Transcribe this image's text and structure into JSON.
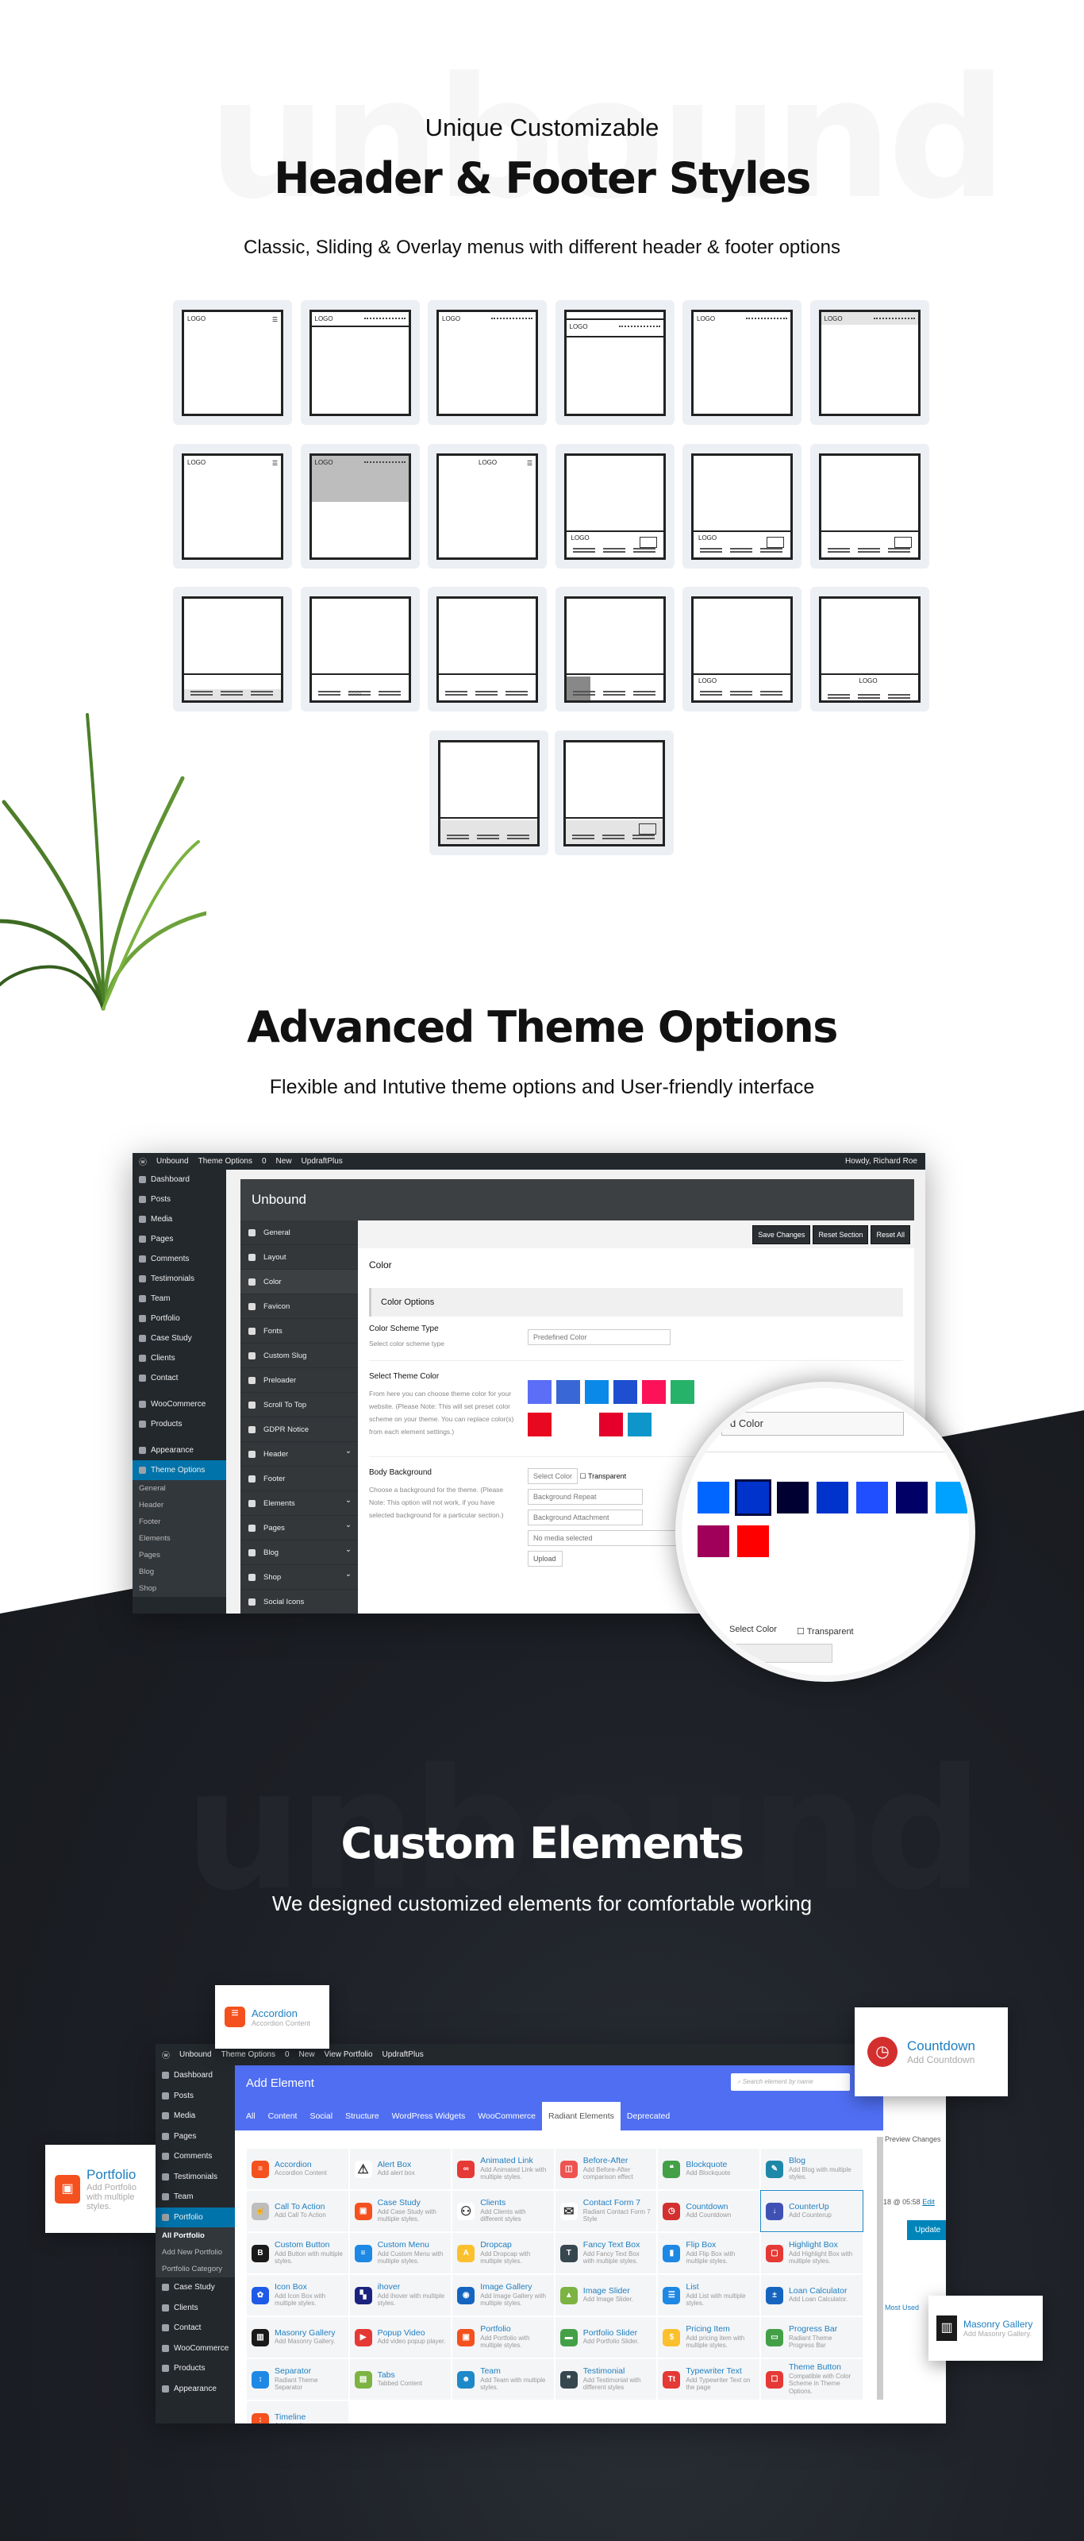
{
  "section1": {
    "watermark": "unbound",
    "subtitle": "Unique Customizable",
    "title": "Header & Footer Styles",
    "description": "Classic, Sliding & Overlay menus with different header & footer options",
    "thumbnails": [
      {
        "kind": "header",
        "variant": "burger",
        "logo": "LOGO"
      },
      {
        "kind": "header",
        "variant": "menu-line",
        "logo": "LOGO"
      },
      {
        "kind": "header",
        "variant": "menu",
        "logo": "LOGO"
      },
      {
        "kind": "header",
        "variant": "topbar",
        "logo": "LOGO"
      },
      {
        "kind": "header",
        "variant": "bold-menu",
        "logo": "LOGO"
      },
      {
        "kind": "header",
        "variant": "grey-bar",
        "logo": "LOGO"
      },
      {
        "kind": "header",
        "variant": "icons",
        "logo": "LOGO"
      },
      {
        "kind": "header",
        "variant": "grey-hero",
        "logo": "LOGO"
      },
      {
        "kind": "header",
        "variant": "centered",
        "logo": "LOGO"
      },
      {
        "kind": "footer",
        "variant": "logo-box",
        "logo": "LOGO"
      },
      {
        "kind": "footer",
        "variant": "logo-lines-box",
        "logo": "LOGO"
      },
      {
        "kind": "footer",
        "variant": "lines-box",
        "logo": ""
      },
      {
        "kind": "footer",
        "variant": "grey-band",
        "logo": ""
      },
      {
        "kind": "footer",
        "variant": "social-dots",
        "logo": ""
      },
      {
        "kind": "footer",
        "variant": "columns",
        "logo": ""
      },
      {
        "kind": "footer",
        "variant": "dark-col",
        "logo": ""
      },
      {
        "kind": "footer",
        "variant": "columns-logo",
        "logo": "LOGO"
      },
      {
        "kind": "footer",
        "variant": "logo-center",
        "logo": "LOGO"
      },
      {
        "kind": "footer",
        "variant": "columns-grey",
        "logo": ""
      },
      {
        "kind": "footer",
        "variant": "grey-box",
        "logo": ""
      }
    ]
  },
  "section2": {
    "title": "Advanced Theme Options",
    "description": "Flexible and Intutive theme options and User-friendly interface",
    "adminbar": {
      "site": "Unbound",
      "theme_options": "Theme Options",
      "comments": "0",
      "new": "New",
      "plugin": "UpdraftPlus",
      "howdy": "Howdy, Richard Roe"
    },
    "sidebar": [
      "Dashboard",
      "Posts",
      "Media",
      "Pages",
      "Comments",
      "Testimonials",
      "Team",
      "Portfolio",
      "Case Study",
      "Clients",
      "Contact",
      "WooCommerce",
      "Products",
      "Appearance",
      "Theme Options"
    ],
    "sidebar_active": "Theme Options",
    "sidebar_sub": [
      "General",
      "Header",
      "Footer",
      "Elements",
      "Pages",
      "Blog",
      "Shop"
    ],
    "panel_title": "Unbound",
    "nav": [
      {
        "label": "General",
        "chev": false
      },
      {
        "label": "Layout",
        "chev": false
      },
      {
        "label": "Color",
        "chev": false
      },
      {
        "label": "Favicon",
        "chev": false
      },
      {
        "label": "Fonts",
        "chev": false
      },
      {
        "label": "Custom Slug",
        "chev": false
      },
      {
        "label": "Preloader",
        "chev": false
      },
      {
        "label": "Scroll To Top",
        "chev": false
      },
      {
        "label": "GDPR Notice",
        "chev": false
      },
      {
        "label": "Header",
        "chev": true
      },
      {
        "label": "Footer",
        "chev": false
      },
      {
        "label": "Elements",
        "chev": true
      },
      {
        "label": "Pages",
        "chev": true
      },
      {
        "label": "Blog",
        "chev": true
      },
      {
        "label": "Shop",
        "chev": true
      },
      {
        "label": "Social Icons",
        "chev": false
      }
    ],
    "buttons": {
      "save": "Save Changes",
      "reset_section": "Reset Section",
      "reset_all": "Reset All"
    },
    "section_title": "Color",
    "group_title": "Color Options",
    "scheme": {
      "label": "Color Scheme Type",
      "help": "Select color scheme type",
      "value": "Predefined Color"
    },
    "theme_color": {
      "label": "Select Theme Color",
      "help": "From here you can choose theme color for your website. (Please Note: This will set preset color scheme on your theme. You can replace color(s) from each element settings.)",
      "swatches": [
        "#5b6ef5",
        "#3a67d6",
        "#0b89e8",
        "#1e4fd0",
        "#fb1259",
        "#27b26a",
        "#e8081f",
        "#e4002b",
        "#0e95c9"
      ]
    },
    "body_bg": {
      "label": "Body Background",
      "help": "Choose a background for the theme. (Please Note: This option will not work, if you have selected background for a particular section.)",
      "select_color": "Select Color",
      "transparent": "Transparent",
      "repeat": "Background Repeat",
      "attachment": "Background Attachment",
      "media": "No media selected",
      "upload": "Upload"
    },
    "magnifier": {
      "select_value": "d Color",
      "swatches": [
        "#0066ff",
        "#0033cc",
        "#000033",
        "#0033cc",
        "#1f4fff",
        "#000066",
        "#00a2ff",
        "#a0005a",
        "#ff0000"
      ],
      "selected_index": 1,
      "select_color": "Select Color",
      "transparent": "Transparent",
      "repeat": "peat"
    }
  },
  "section3": {
    "watermark": "unbound",
    "title": "Custom Elements",
    "description": "We designed customized elements  for comfortable working",
    "adminbar": {
      "site": "Unbound",
      "theme_options": "Theme Options",
      "comments": "0",
      "new": "New",
      "view": "View Portfolio",
      "plugin": "UpdraftPlus"
    },
    "sidebar": [
      "Dashboard",
      "Posts",
      "Media",
      "Pages",
      "Comments",
      "Testimonials",
      "Team",
      "Portfolio"
    ],
    "sidebar_sub": [
      "All Portfolio",
      "Add New Portfolio",
      "Portfolio Category"
    ],
    "sidebar_after": [
      "Case Study",
      "Clients",
      "Contact",
      "WooCommerce",
      "Products",
      "Appearance"
    ],
    "modal_title": "Add Element",
    "search_placeholder": "Search element by name",
    "tabs": [
      "All",
      "Content",
      "Social",
      "Structure",
      "WordPress Widgets",
      "WooCommerce",
      "Radiant Elements",
      "Deprecated"
    ],
    "active_tab": "Radiant Elements",
    "right": {
      "preview": "Preview Changes",
      "date": "18 @ 05:58",
      "edit": "Edit",
      "update": "Update",
      "most_used": "Most Used"
    },
    "elements": [
      {
        "t": "Accordion",
        "d": "Accordion Content",
        "c": "#f4511e",
        "g": "≡"
      },
      {
        "t": "Alert Box",
        "d": "Add alert box",
        "c": "#ffffff",
        "g": "⚠"
      },
      {
        "t": "Animated Link",
        "d": "Add Animated Link with multiple styles.",
        "c": "#e53935",
        "g": "∞"
      },
      {
        "t": "Before-After",
        "d": "Add Before-After comparison effect",
        "c": "#ef5350",
        "g": "◫"
      },
      {
        "t": "Blockquote",
        "d": "Add Blockquote",
        "c": "#43a047",
        "g": "❝"
      },
      {
        "t": "Blog",
        "d": "Add Blog with multiple styles.",
        "c": "#1e88a8",
        "g": "✎"
      },
      {
        "t": "Call To Action",
        "d": "Add Call To Action",
        "c": "#bdbdbd",
        "g": "☝"
      },
      {
        "t": "Case Study",
        "d": "Add Case Study with multiple styles.",
        "c": "#f4511e",
        "g": "▣"
      },
      {
        "t": "Clients",
        "d": "Add Clients with different styles",
        "c": "#ffffff",
        "g": "⚇"
      },
      {
        "t": "Contact Form 7",
        "d": "Radiant Contact Form 7 Style",
        "c": "#ffffff",
        "g": "✉"
      },
      {
        "t": "Countdown",
        "d": "Add Countdown",
        "c": "#d32f2f",
        "g": "◷"
      },
      {
        "t": "CounterUp",
        "d": "Add Counterup",
        "c": "#3f51b5",
        "g": "↓"
      },
      {
        "t": "Custom Button",
        "d": "Add Button with multiple styles.",
        "c": "#1a1a1a",
        "g": "B"
      },
      {
        "t": "Custom Menu",
        "d": "Add Custom Menu with multiple styles.",
        "c": "#1e88e5",
        "g": "≡"
      },
      {
        "t": "Dropcap",
        "d": "Add Dropcap with multiple styles.",
        "c": "#fbc02d",
        "g": "A"
      },
      {
        "t": "Fancy Text Box",
        "d": "Add Fancy Text Box with multiple styles.",
        "c": "#37474f",
        "g": "T"
      },
      {
        "t": "Flip Box",
        "d": "Add Flip Box with multiple styles.",
        "c": "#1e88e5",
        "g": "▮"
      },
      {
        "t": "Highlight Box",
        "d": "Add Highlight Box with multiple styles.",
        "c": "#e53935",
        "g": "▢"
      },
      {
        "t": "Icon Box",
        "d": "Add Icon Box with multiple styles.",
        "c": "#1e5ae8",
        "g": "✿"
      },
      {
        "t": "ihover",
        "d": "Add ihover with multiple styles.",
        "c": "#1a237e",
        "g": "▚"
      },
      {
        "t": "Image Gallery",
        "d": "Add Image Gallery with multiple styles.",
        "c": "#1565c0",
        "g": "◉"
      },
      {
        "t": "Image Slider",
        "d": "Add Image Slider.",
        "c": "#7cb342",
        "g": "▲"
      },
      {
        "t": "List",
        "d": "Add List with multiple styles.",
        "c": "#1e88e5",
        "g": "☰"
      },
      {
        "t": "Loan Calculator",
        "d": "Add Loan Calculator.",
        "c": "#1565c0",
        "g": "±"
      },
      {
        "t": "Masonry Gallery",
        "d": "Add Masonry Gallery.",
        "c": "#1a1a1a",
        "g": "▥"
      },
      {
        "t": "Popup Video",
        "d": "Add video popup player.",
        "c": "#e53935",
        "g": "▶"
      },
      {
        "t": "Portfolio",
        "d": "Add Portfolio with multiple styles.",
        "c": "#f4511e",
        "g": "▣"
      },
      {
        "t": "Portfolio Slider",
        "d": "Add Portfolio Slider.",
        "c": "#43a047",
        "g": "▬"
      },
      {
        "t": "Pricing Item",
        "d": "Add pricing item with multiple styles.",
        "c": "#fbc02d",
        "g": "$"
      },
      {
        "t": "Progress Bar",
        "d": "Radiant Theme Progress Bar",
        "c": "#43a047",
        "g": "▭"
      },
      {
        "t": "Separator",
        "d": "Radiant Theme Separator",
        "c": "#1e88e5",
        "g": "↕"
      },
      {
        "t": "Tabs",
        "d": "Tabbed Content",
        "c": "#7cb342",
        "g": "▤"
      },
      {
        "t": "Team",
        "d": "Add Team with multiple styles.",
        "c": "#1e88c8",
        "g": "☻"
      },
      {
        "t": "Testimonial",
        "d": "Add Testimonial with different styles",
        "c": "#37474f",
        "g": "❞"
      },
      {
        "t": "Typewriter Text",
        "d": "Add Typewriter Text on the page",
        "c": "#e53935",
        "g": "Tt"
      },
      {
        "t": "Theme Button",
        "d": "Compatible with Color Scheme in Theme Options.",
        "c": "#e53935",
        "g": "☐"
      },
      {
        "t": "Timeline",
        "d": "Add timeline",
        "c": "#f4511e",
        "g": "⋮"
      }
    ],
    "highlighted": "CounterUp",
    "cards": {
      "accordion": {
        "t": "Accordion",
        "d": "Accordion Content"
      },
      "countdown": {
        "t": "Countdown",
        "d": "Add Countdown"
      },
      "portfolio": {
        "t": "Portfolio",
        "d": "Add Portfolio with multiple styles."
      },
      "masonry": {
        "t": "Masonry Gallery",
        "d": "Add Masonry Gallery."
      }
    }
  },
  "colors": {
    "accent_blue": "#4f6ef2",
    "wp_active": "#0073aa",
    "dark_bg": "#1c1f25",
    "link": "#1e7fc0"
  }
}
